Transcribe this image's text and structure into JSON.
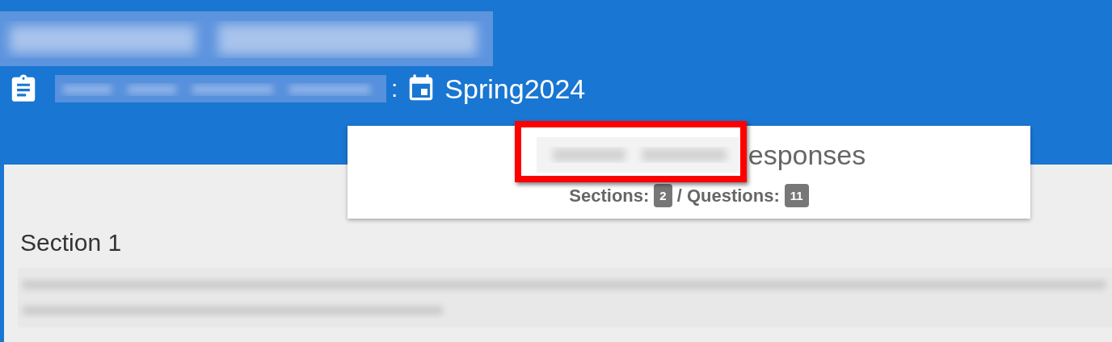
{
  "header": {
    "separator": ":",
    "term": "Spring2024"
  },
  "card": {
    "title_suffix": "esponses",
    "sections_label": "Sections:",
    "sections_count": "2",
    "questions_label": "/ Questions:",
    "questions_count": "11"
  },
  "annotation": {
    "kind": "highlight-box"
  },
  "section": {
    "heading": "Section 1"
  }
}
